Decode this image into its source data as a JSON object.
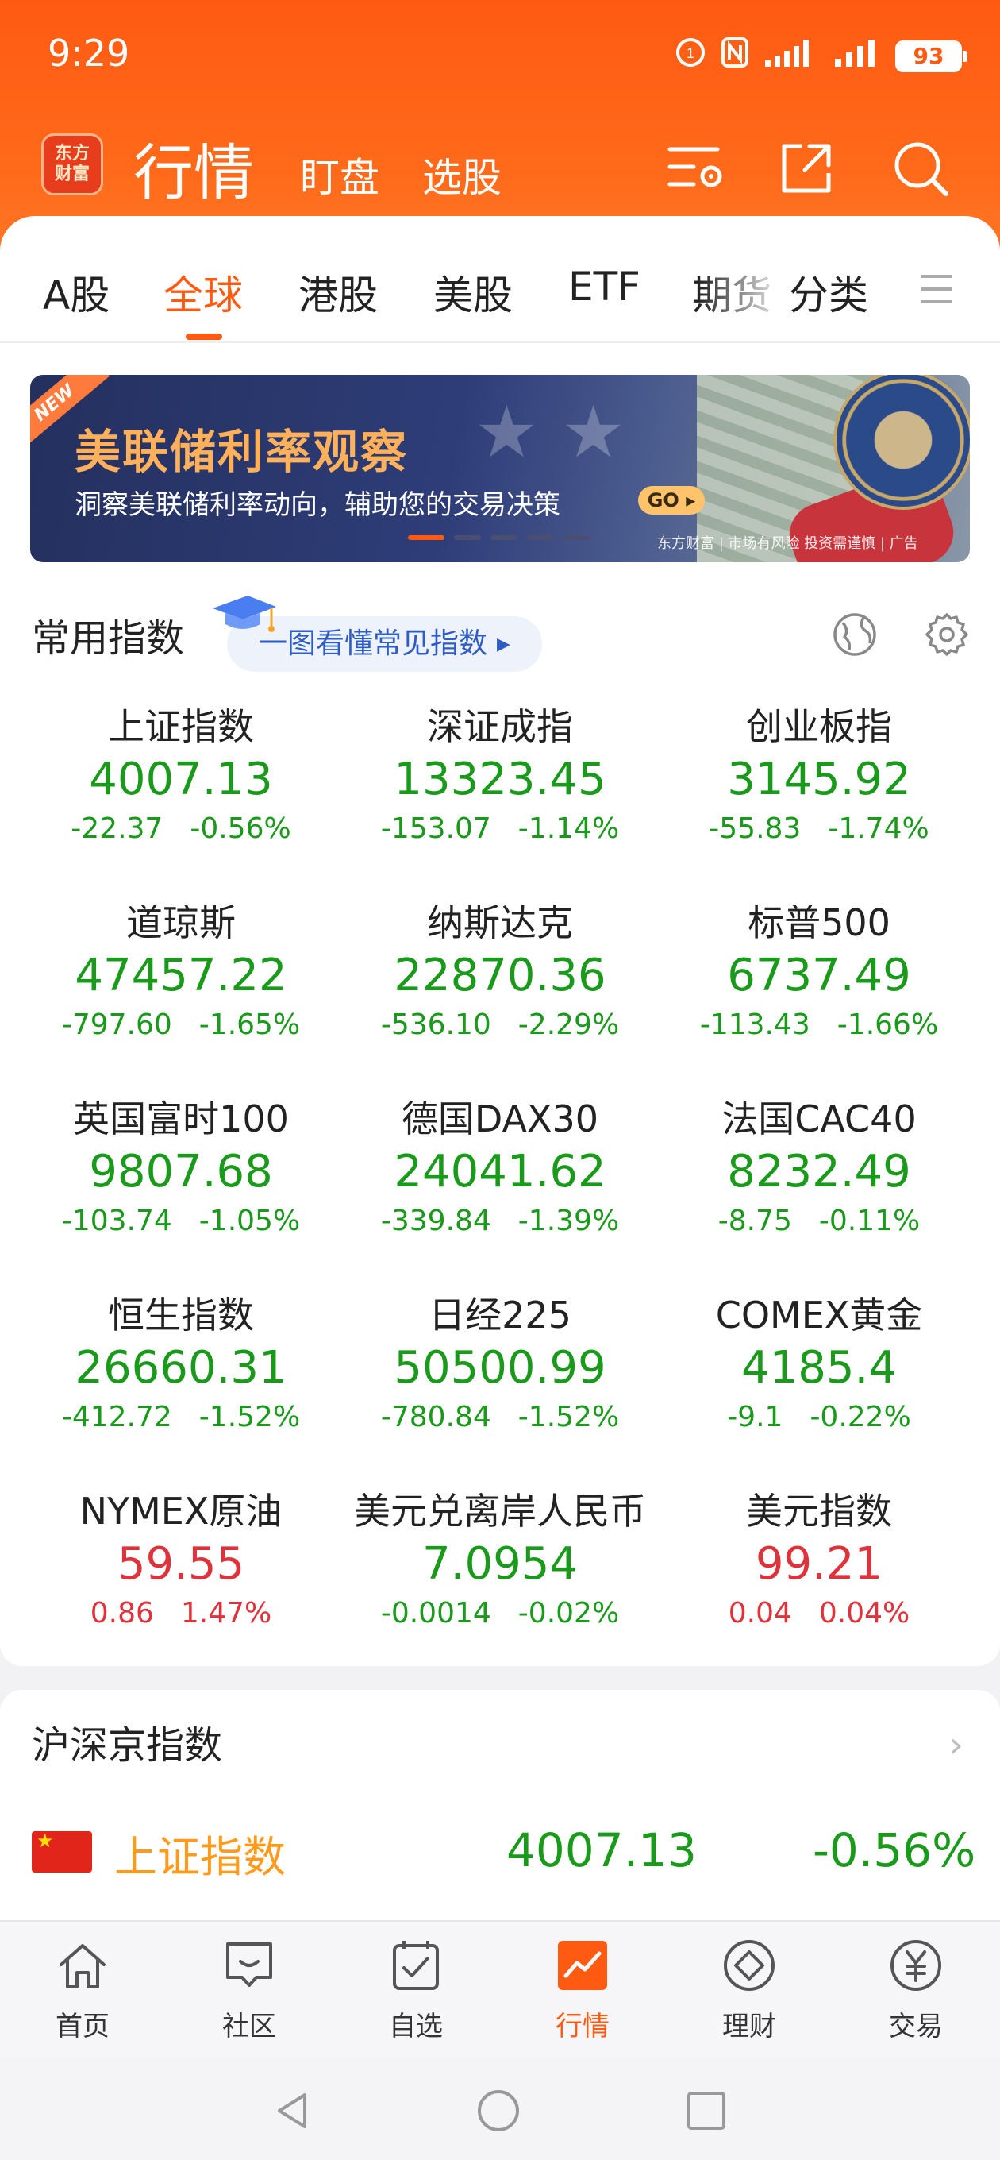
{
  "status": {
    "time": "9:29",
    "battery": "93"
  },
  "topnav": {
    "logo_text": "东方\n财富",
    "title": "行情",
    "sub1": "盯盘",
    "sub2": "选股"
  },
  "tabs": [
    {
      "label": "A股"
    },
    {
      "label": "全球"
    },
    {
      "label": "港股"
    },
    {
      "label": "美股"
    },
    {
      "label": "ETF"
    },
    {
      "label": "期货"
    },
    {
      "label": "分类"
    }
  ],
  "banner": {
    "ribbon": "NEW",
    "title": "美联储利率观察",
    "subtitle": "洞察美联储利率动向，辅助您的交易决策",
    "go": "GO",
    "disclaimer": "东方财富 | 市场有风险 投资需谨慎 | 广告"
  },
  "common_indices": {
    "title": "常用指数",
    "guide_pill": "一图看懂常见指数",
    "items": [
      {
        "name": "上证指数",
        "value": "4007.13",
        "change": "-22.37",
        "pct": "-0.56%",
        "dir": "down"
      },
      {
        "name": "深证成指",
        "value": "13323.45",
        "change": "-153.07",
        "pct": "-1.14%",
        "dir": "down"
      },
      {
        "name": "创业板指",
        "value": "3145.92",
        "change": "-55.83",
        "pct": "-1.74%",
        "dir": "down"
      },
      {
        "name": "道琼斯",
        "value": "47457.22",
        "change": "-797.60",
        "pct": "-1.65%",
        "dir": "down"
      },
      {
        "name": "纳斯达克",
        "value": "22870.36",
        "change": "-536.10",
        "pct": "-2.29%",
        "dir": "down"
      },
      {
        "name": "标普500",
        "value": "6737.49",
        "change": "-113.43",
        "pct": "-1.66%",
        "dir": "down"
      },
      {
        "name": "英国富时100",
        "value": "9807.68",
        "change": "-103.74",
        "pct": "-1.05%",
        "dir": "down"
      },
      {
        "name": "德国DAX30",
        "value": "24041.62",
        "change": "-339.84",
        "pct": "-1.39%",
        "dir": "down"
      },
      {
        "name": "法国CAC40",
        "value": "8232.49",
        "change": "-8.75",
        "pct": "-0.11%",
        "dir": "down"
      },
      {
        "name": "恒生指数",
        "value": "26660.31",
        "change": "-412.72",
        "pct": "-1.52%",
        "dir": "down"
      },
      {
        "name": "日经225",
        "value": "50500.99",
        "change": "-780.84",
        "pct": "-1.52%",
        "dir": "down"
      },
      {
        "name": "COMEX黄金",
        "value": "4185.4",
        "change": "-9.1",
        "pct": "-0.22%",
        "dir": "down"
      },
      {
        "name": "NYMEX原油",
        "value": "59.55",
        "change": "0.86",
        "pct": "1.47%",
        "dir": "up"
      },
      {
        "name": "美元兑离岸人民币",
        "value": "7.0954",
        "change": "-0.0014",
        "pct": "-0.02%",
        "dir": "down"
      },
      {
        "name": "美元指数",
        "value": "99.21",
        "change": "0.04",
        "pct": "0.04%",
        "dir": "up"
      }
    ]
  },
  "hs_section": {
    "title": "沪深京指数",
    "row": {
      "name": "上证指数",
      "value": "4007.13",
      "pct": "-0.56%"
    }
  },
  "bottom_nav": [
    {
      "label": "首页",
      "icon": "home-icon"
    },
    {
      "label": "社区",
      "icon": "chat-icon"
    },
    {
      "label": "自选",
      "icon": "checkbox-icon"
    },
    {
      "label": "行情",
      "icon": "chart-icon",
      "active": true
    },
    {
      "label": "理财",
      "icon": "diamond-icon"
    },
    {
      "label": "交易",
      "icon": "yen-icon"
    }
  ],
  "colors": {
    "brand": "#ff5a12",
    "down": "#1a9a1a",
    "up": "#e0323a"
  }
}
